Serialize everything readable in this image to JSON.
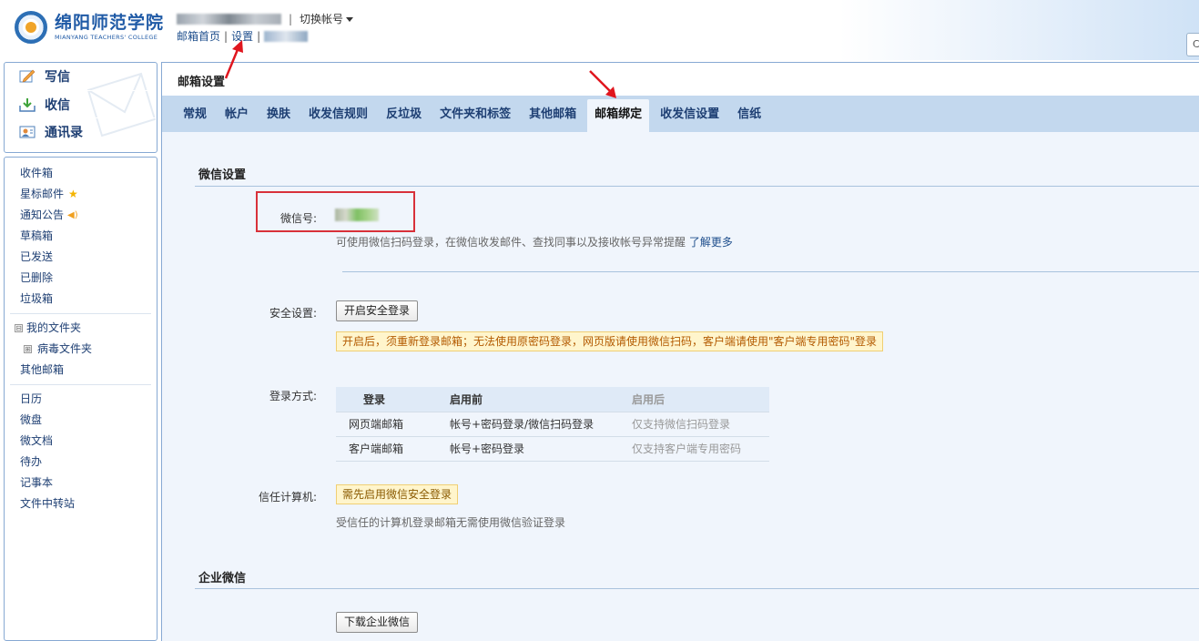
{
  "header": {
    "logo_cn": "绵阳师范学院",
    "logo_en": "MIANYANG TEACHERS' COLLEGE",
    "switch_account": "切换帐号",
    "nav": {
      "home": "邮箱首页",
      "settings": "设置",
      "separator": "|"
    },
    "corner_char": "C"
  },
  "sidebar": {
    "tools": [
      {
        "label": "写信",
        "icon": "compose-icon"
      },
      {
        "label": "收信",
        "icon": "inbox-download-icon"
      },
      {
        "label": "通讯录",
        "icon": "contacts-icon"
      }
    ],
    "folders_a": [
      "收件箱",
      "星标邮件",
      "通知公告",
      "草稿箱",
      "已发送",
      "已删除",
      "垃圾箱"
    ],
    "my_folders": "我的文件夹",
    "virus_folder": "病毒文件夹",
    "other_mailbox": "其他邮箱",
    "apps": [
      "日历",
      "微盘",
      "微文档",
      "待办",
      "记事本",
      "文件中转站"
    ],
    "tree_collapse": "⊟",
    "tree_expand": "⊞"
  },
  "main": {
    "title": "邮箱设置",
    "tabs": [
      "常规",
      "帐户",
      "换肤",
      "收发信规则",
      "反垃圾",
      "文件夹和标签",
      "其他邮箱",
      "邮箱绑定",
      "收发信设置",
      "信纸"
    ],
    "active_tab": 7
  },
  "wechat": {
    "section_title": "微信设置",
    "wechat_id_label": "微信号:",
    "hint": "可使用微信扫码登录，在微信收发邮件、查找同事以及接收帐号异常提醒",
    "learn_more": "了解更多",
    "security_label": "安全设置:",
    "security_button": "开启安全登录",
    "security_warning": "开启后，须重新登录邮箱；无法使用原密码登录，网页版请使用微信扫码，客户端请使用\"客户端专用密码\"登录",
    "login_method_label": "登录方式:",
    "table": {
      "headers": [
        "登录",
        "启用前",
        "启用后"
      ],
      "rows": [
        [
          "网页端邮箱",
          "帐号+密码登录/微信扫码登录",
          "仅支持微信扫码登录"
        ],
        [
          "客户端邮箱",
          "帐号+密码登录",
          "仅支持客户端专用密码"
        ]
      ]
    },
    "trusted_label": "信任计算机:",
    "trusted_notice": "需先启用微信安全登录",
    "trusted_hint": "受信任的计算机登录邮箱无需使用微信验证登录"
  },
  "enterprise": {
    "section_title": "企业微信",
    "download_button": "下载企业微信"
  },
  "colors": {
    "accent_blue": "#1e4e8c",
    "tab_bar": "#c3d8ee",
    "content_bg": "#f0f5fc",
    "highlight_red": "#d8313a",
    "warning_bg": "#fff5cc"
  }
}
